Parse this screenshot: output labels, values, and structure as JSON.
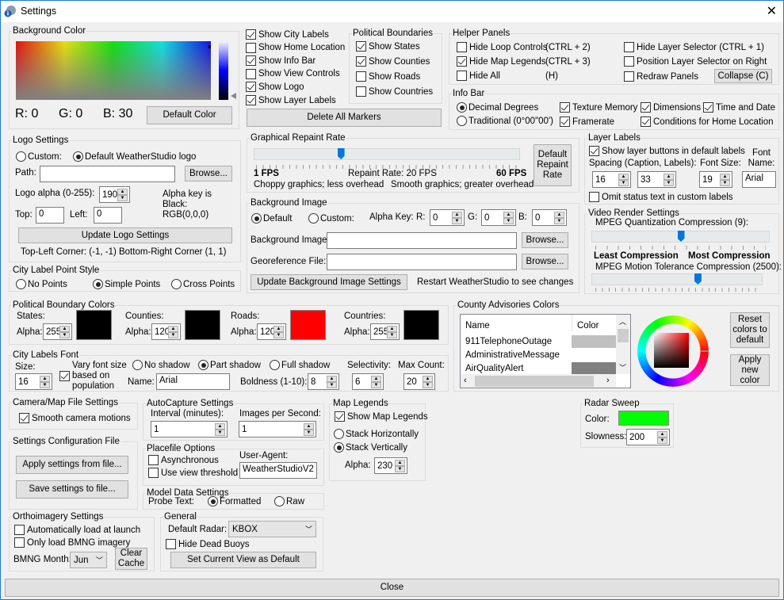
{
  "window": {
    "title": "Settings",
    "close_label": "✕"
  },
  "background_color": {
    "legend": "Background Color",
    "r_label": "R: 0",
    "g_label": "G: 0",
    "b_label": "B: 30",
    "default_button": "Default Color"
  },
  "display_options": {
    "items": [
      {
        "label": "Show City Labels",
        "checked": true
      },
      {
        "label": "Show Home Location",
        "checked": false
      },
      {
        "label": "Show Info Bar",
        "checked": true
      },
      {
        "label": "Show View Controls",
        "checked": false
      },
      {
        "label": "Show Logo",
        "checked": true
      },
      {
        "label": "Show Layer Labels",
        "checked": true
      }
    ],
    "delete_markers_button": "Delete All Markers"
  },
  "political_boundaries": {
    "legend": "Political Boundaries",
    "items": [
      {
        "label": "Show States",
        "checked": true
      },
      {
        "label": "Show Counties",
        "checked": true
      },
      {
        "label": "Show Roads",
        "checked": false
      },
      {
        "label": "Show Countries",
        "checked": false
      }
    ]
  },
  "helper_panels": {
    "legend": "Helper Panels",
    "hide_loop": {
      "label": "Hide Loop Controls",
      "shortcut": "(CTRL + 2)",
      "checked": false
    },
    "hide_legends": {
      "label": "Hide Map Legends",
      "shortcut": "(CTRL + 3)",
      "checked": true
    },
    "hide_all": {
      "label": "Hide All",
      "shortcut": "(H)",
      "checked": false
    },
    "hide_layer_selector": {
      "label": "Hide Layer Selector (CTRL + 1)",
      "checked": false
    },
    "position_right": {
      "label": "Position Layer Selector on Right",
      "checked": false
    },
    "redraw": {
      "label": "Redraw Panels",
      "checked": false
    },
    "collapse_button": "Collapse (C)"
  },
  "info_bar": {
    "legend": "Info Bar",
    "decimal": {
      "label": "Decimal Degrees",
      "selected": true
    },
    "traditional": {
      "label": "Traditional (0°00\"00')",
      "selected": false
    },
    "texture_memory": {
      "label": "Texture Memory",
      "checked": true
    },
    "dimensions": {
      "label": "Dimensions",
      "checked": true
    },
    "time_date": {
      "label": "Time and Date",
      "checked": true
    },
    "framerate": {
      "label": "Framerate",
      "checked": true
    },
    "conditions": {
      "label": "Conditions for Home Location",
      "checked": true
    }
  },
  "logo_settings": {
    "legend": "Logo Settings",
    "custom_label": "Custom:",
    "default_label": "Default WeatherStudio logo",
    "path_label": "Path:",
    "path_value": "",
    "browse_button": "Browse...",
    "alpha_label": "Logo alpha (0-255):",
    "alpha_value": "190",
    "alpha_key_note": [
      "Alpha key is",
      "Black:",
      "RGB(0,0,0)"
    ],
    "top_label": "Top:",
    "top_value": "0",
    "left_label": "Left:",
    "left_value": "0",
    "update_button": "Update Logo Settings",
    "corner_note": "Top-Left Corner: (-1, -1) Bottom-Right Corner (1, 1)"
  },
  "city_point_style": {
    "legend": "City Label Point Style",
    "options": [
      {
        "label": "No Points",
        "selected": false
      },
      {
        "label": "Simple Points",
        "selected": true
      },
      {
        "label": "Cross Points",
        "selected": false
      }
    ]
  },
  "repaint_rate": {
    "legend": "Graphical Repaint Rate",
    "value_fraction": 0.32,
    "min_label": "1 FPS",
    "max_label": "60 FPS",
    "current_label": "Repaint Rate: 20 FPS",
    "left_note": "Choppy graphics; less overhead",
    "right_note": "Smooth graphics; greater overhead",
    "default_button": "Default Repaint Rate"
  },
  "background_image": {
    "legend": "Background Image",
    "default_label": "Default",
    "custom_label": "Custom:",
    "alpha_key_label": "Alpha Key:",
    "r_label": "R:",
    "r_value": "0",
    "g_label": "G:",
    "g_value": "0",
    "b_label": "B:",
    "b_value": "0",
    "image_label": "Background Image:",
    "image_value": "",
    "georef_label": "Georeference File:",
    "georef_value": "",
    "browse_button": "Browse...",
    "update_button": "Update Background Image Settings",
    "restart_note": "Restart WeatherStudio to see changes"
  },
  "layer_labels": {
    "legend": "Layer Labels",
    "show_buttons": {
      "label": "Show layer buttons in default labels",
      "checked": true
    },
    "spacing_label": "Spacing (Caption, Labels):",
    "spacing_caption": "16",
    "spacing_labels": "33",
    "font_size_label": "Font Size:",
    "font_size_value": "19",
    "font_name_label": "Font Name:",
    "font_name_value": "Arial",
    "omit_status": {
      "label": "Omit status text in custom labels",
      "checked": false
    }
  },
  "video_render": {
    "legend": "Video Render Settings",
    "quant_label": "MPEG Quantization Compression (9):",
    "quant_fraction": 0.5,
    "least_label": "Least Compression",
    "most_label": "Most Compression",
    "motion_label": "MPEG Motion Tolerance Compression (2500):",
    "motion_fraction": 0.62
  },
  "boundary_colors": {
    "legend": "Political Boundary Colors",
    "alpha_label": "Alpha:",
    "items": [
      {
        "label": "States:",
        "alpha": "255",
        "color": "#000000"
      },
      {
        "label": "Counties:",
        "alpha": "120",
        "color": "#000000"
      },
      {
        "label": "Roads:",
        "alpha": "120",
        "color": "#ff0000"
      },
      {
        "label": "Countries:",
        "alpha": "255",
        "color": "#000000"
      }
    ]
  },
  "city_font": {
    "legend": "City Labels Font",
    "size_label": "Size:",
    "size_value": "16",
    "vary": {
      "label": [
        "Vary font size",
        "based on",
        "population"
      ],
      "checked": true
    },
    "shadow_options": [
      {
        "label": "No shadow",
        "selected": false
      },
      {
        "label": "Part shadow",
        "selected": true
      },
      {
        "label": "Full shadow",
        "selected": false
      }
    ],
    "name_label": "Name:",
    "name_value": "Arial",
    "boldness_label": "Boldness (1-10):",
    "boldness_value": "8",
    "selectivity_label": "Selectivity:",
    "selectivity_value": "6",
    "max_count_label": "Max Count:",
    "max_count_value": "20"
  },
  "county_advisories": {
    "legend": "County Advisories Colors",
    "columns": [
      "Name",
      "Color"
    ],
    "rows": [
      {
        "name": "911TelephoneOutage",
        "color": "#c0c0c0"
      },
      {
        "name": "AdministrativeMessage",
        "color": "#ffffff"
      },
      {
        "name": "AirQualityAlert",
        "color": "#808080"
      }
    ],
    "reset_button": "Reset colors to default",
    "apply_button": "Apply new color"
  },
  "camera": {
    "legend": "Camera/Map File Settings",
    "smooth": {
      "label": "Smooth camera motions",
      "checked": true
    }
  },
  "config_file": {
    "legend": "Settings Configuration File",
    "apply_button": "Apply settings from file...",
    "save_button": "Save settings to file..."
  },
  "autocapture": {
    "legend": "AutoCapture Settings",
    "interval_label": "Interval (minutes):",
    "interval_value": "1",
    "ips_label": "Images per Second:",
    "ips_value": "1"
  },
  "placefile": {
    "legend": "Placefile Options",
    "async": {
      "label": "Asynchronous",
      "checked": false
    },
    "threshold": {
      "label": "Use view threshold",
      "checked": false
    },
    "user_agent_label": "User-Agent:",
    "user_agent_value": "WeatherStudioV2"
  },
  "model_data": {
    "legend": "Model Data Settings",
    "probe_label": "Probe Text:",
    "formatted": {
      "label": "Formatted",
      "selected": true
    },
    "raw": {
      "label": "Raw",
      "selected": false
    }
  },
  "map_legends": {
    "legend": "Map Legends",
    "show": {
      "label": "Show Map Legends",
      "checked": true
    },
    "horizontal": {
      "label": "Stack Horizontally",
      "selected": false
    },
    "vertical": {
      "label": "Stack Vertically",
      "selected": true
    },
    "alpha_label": "Alpha:",
    "alpha_value": "230"
  },
  "radar_sweep": {
    "legend": "Radar Sweep",
    "color_label": "Color:",
    "color": "#00ff00",
    "slowness_label": "Slowness:",
    "slowness_value": "200"
  },
  "orthoimagery": {
    "legend": "Orthoimagery Settings",
    "auto_load": {
      "label": "Automatically load at launch",
      "checked": false
    },
    "bmng_only": {
      "label": "Only load BMNG imagery",
      "checked": false
    },
    "month_label": "BMNG Month:",
    "month_value": "Jun",
    "clear_button": "Clear Cache"
  },
  "general": {
    "legend": "General",
    "radar_label": "Default Radar:",
    "radar_value": "KBOX",
    "hide_buoys": {
      "label": "Hide Dead Buoys",
      "checked": false
    },
    "set_view_button": "Set Current View as Default"
  },
  "footer": {
    "close_button": "Close"
  }
}
